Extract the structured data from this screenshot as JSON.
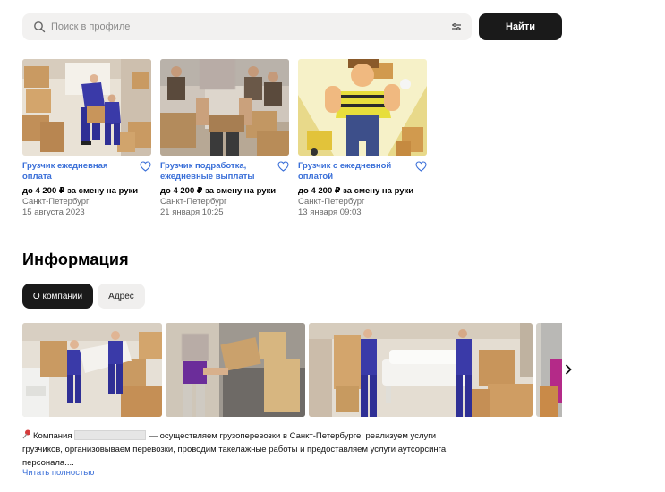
{
  "search": {
    "placeholder": "Поиск в профиле",
    "button_label": "Найти"
  },
  "listings": [
    {
      "title": "Грузчик ежедневная оплата",
      "price": "до 4 200 ₽ за смену на руки",
      "city": "Санкт-Петербург",
      "date": "15 августа 2023"
    },
    {
      "title": "Грузчик подработка, ежедневные выплаты",
      "price": "до 4 200 ₽ за смену на руки",
      "city": "Санкт-Петербург",
      "date": "21 января 10:25"
    },
    {
      "title": "Грузчик с ежедневной оплатой",
      "price": "до 4 200 ₽ за смену на руки",
      "city": "Санкт-Петербург",
      "date": "13 января 09:03"
    }
  ],
  "info": {
    "title": "Информация",
    "tabs": [
      {
        "label": "О компании",
        "active": true
      },
      {
        "label": "Адрес",
        "active": false
      }
    ],
    "description_prefix": "Компания",
    "description_rest": "— осуществляем грузоперевозки в Санкт-Петербурге: реализуем услуги грузчиков, организовываем перевозки, проводим такелажные работы и предоставляем услуги аутсорсинга персонала....",
    "read_more": "Читать полностью"
  },
  "icons": {
    "search": "search-icon",
    "filter": "filter-icon",
    "favorite": "heart-icon",
    "next": "chevron-right-icon",
    "pin": "pushpin-icon"
  },
  "colors": {
    "accent_link": "#3a6fd8",
    "button_dark": "#1a1a1a",
    "search_bg": "#f2f1f0"
  }
}
